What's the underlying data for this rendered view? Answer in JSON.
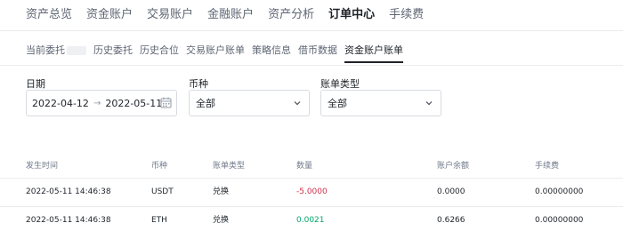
{
  "top_nav": {
    "items": [
      "资产总览",
      "资金账户",
      "交易账户",
      "金融账户",
      "资产分析",
      "订单中心",
      "手续费"
    ],
    "active_index": 5
  },
  "sub_nav": {
    "items": [
      "当前委托",
      "历史委托",
      "历史合位",
      "交易账户账单",
      "策略信息",
      "借币数据",
      "资金账户账单"
    ],
    "active_index": 6
  },
  "filters": {
    "date_label": "日期",
    "date_from": "2022-04-12",
    "date_arrow": "→",
    "date_to": "2022-05-11",
    "coin_label": "币种",
    "coin_value": "全部",
    "type_label": "账单类型",
    "type_value": "全部"
  },
  "table": {
    "headers": [
      "发生时间",
      "币种",
      "账单类型",
      "数量",
      "账户余额",
      "手续费"
    ],
    "rows": [
      {
        "time": "2022-05-11 14:46:38",
        "coin": "USDT",
        "type": "兑换",
        "amount": "-5.0000",
        "amount_sign": "negative",
        "balance": "0.0000",
        "fee": "0.00000000"
      },
      {
        "time": "2022-05-11 14:46:38",
        "coin": "ETH",
        "type": "兑换",
        "amount": "0.0021",
        "amount_sign": "positive",
        "balance": "0.6266",
        "fee": "0.00000000"
      }
    ]
  },
  "icons": {
    "calendar": "calendar-icon",
    "dropdown": "chevron-down-icon"
  },
  "colors": {
    "negative": "#cf304a",
    "positive": "#03a66d",
    "active_underline": "#1e2329"
  }
}
